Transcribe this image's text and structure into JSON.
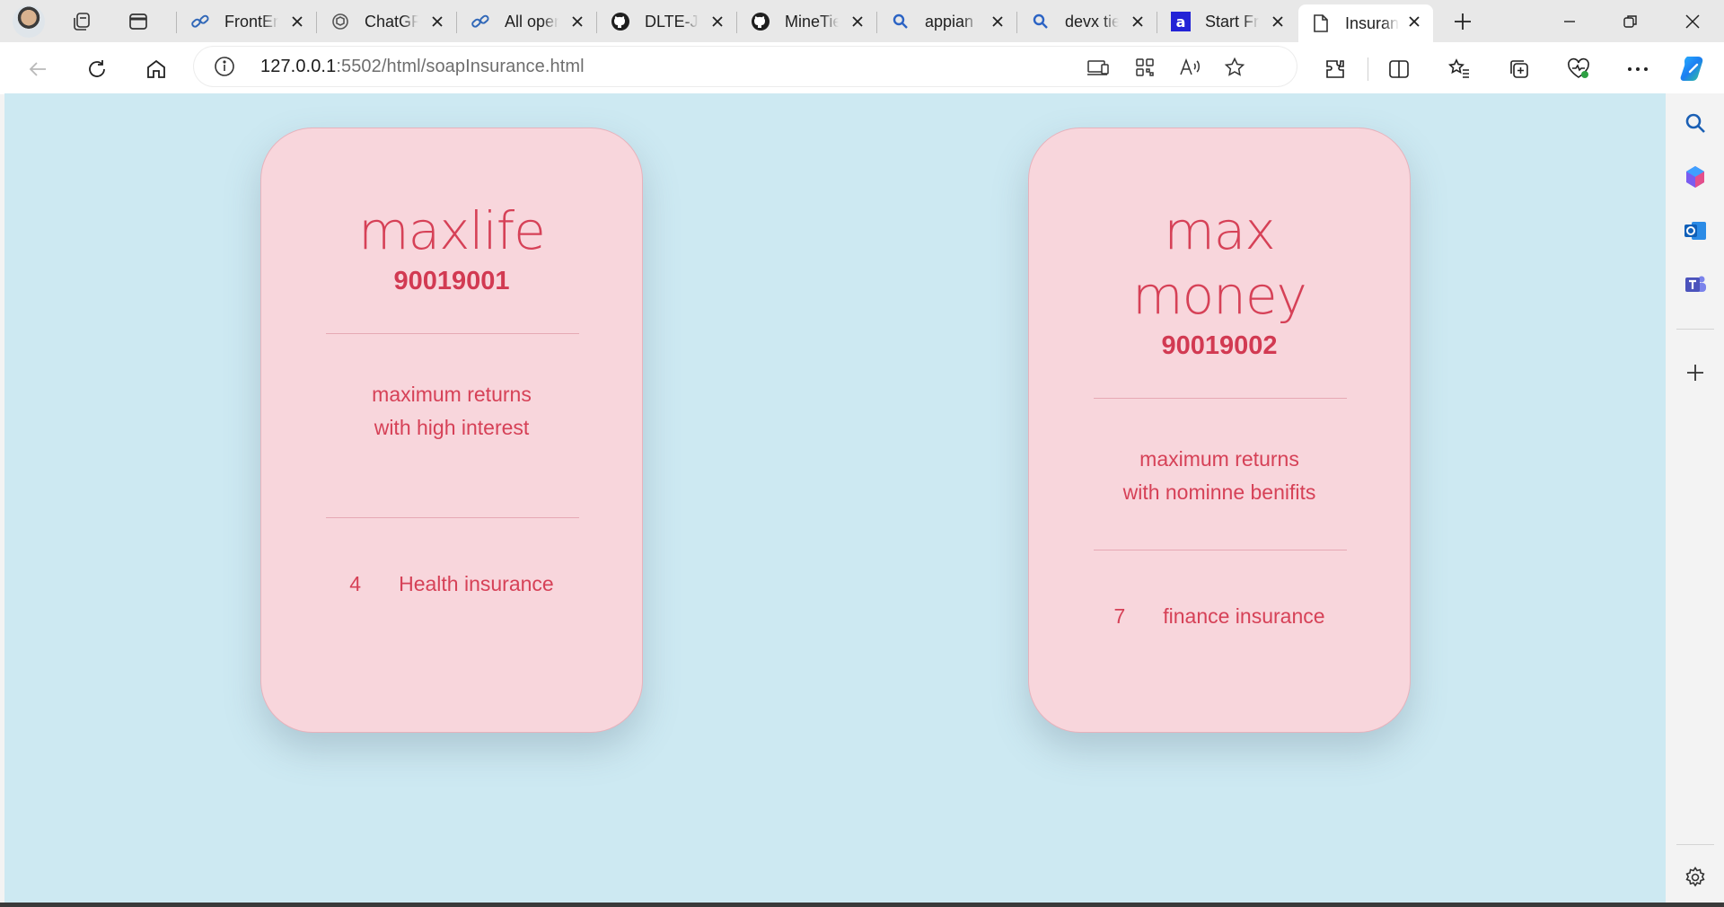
{
  "browser": {
    "tabs": [
      {
        "title": "FrontEnd",
        "icon": "link-icon",
        "active": false
      },
      {
        "title": "ChatGPT",
        "icon": "chatgpt-icon",
        "active": false
      },
      {
        "title": "All open",
        "icon": "link-icon",
        "active": false
      },
      {
        "title": "DLTE-Ja",
        "icon": "github-icon",
        "active": false
      },
      {
        "title": "MineTie",
        "icon": "github-icon",
        "active": false
      },
      {
        "title": "appian",
        "icon": "search-icon",
        "active": false
      },
      {
        "title": "devx tie",
        "icon": "search-icon",
        "active": false
      },
      {
        "title": "Start Fr",
        "icon": "a-logo-icon",
        "active": false
      },
      {
        "title": "Insuran",
        "icon": "page-icon",
        "active": true
      }
    ],
    "address": {
      "host": "127.0.0.1",
      "rest": ":5502/html/soapInsurance.html"
    },
    "accent": "#0f6cbd"
  },
  "page": {
    "background": "#cde9f2",
    "card_color": "#f8d6dc",
    "text_color": "#d64157",
    "cards": [
      {
        "name_lines": [
          "maxlife"
        ],
        "id": "90019001",
        "desc_lines": [
          "maximum returns",
          "with high interest"
        ],
        "count": "4",
        "type": "Health insurance"
      },
      {
        "name_lines": [
          "max",
          "money"
        ],
        "id": "90019002",
        "desc_lines": [
          "maximum returns",
          "with nominne benifits"
        ],
        "count": "7",
        "type": "finance insurance"
      }
    ]
  }
}
